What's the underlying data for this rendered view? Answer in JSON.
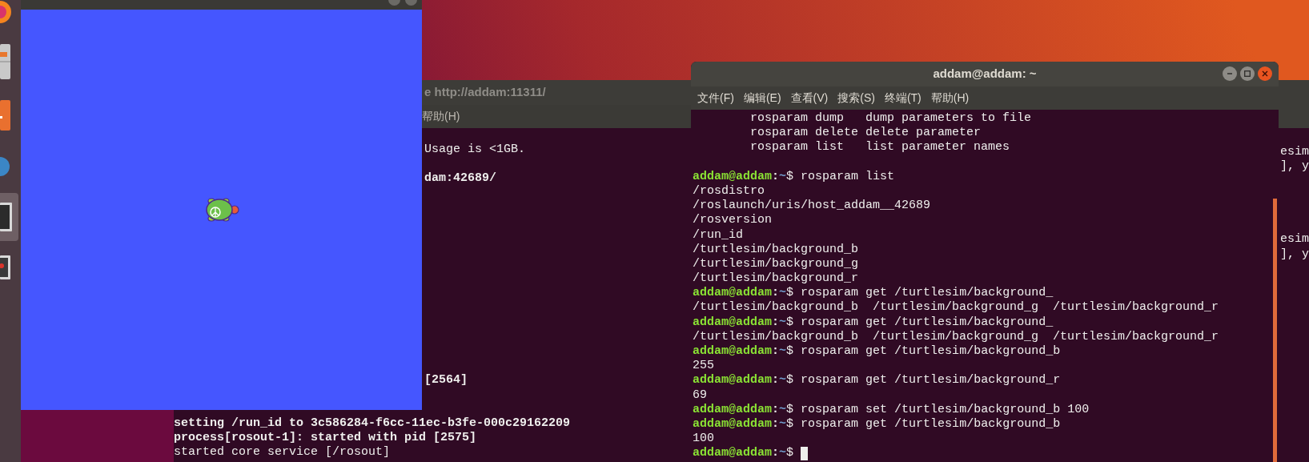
{
  "dock": {
    "items": [
      {
        "kind": "browser",
        "selected": false
      },
      {
        "kind": "files",
        "selected": false
      },
      {
        "kind": "software",
        "selected": false
      },
      {
        "kind": "globe",
        "selected": false
      },
      {
        "kind": "terminal",
        "selected": true
      },
      {
        "kind": "monitor",
        "selected": false
      }
    ]
  },
  "roscore_terminal": {
    "title": "e http://addam:11311/",
    "menu": [
      "帮助(H)"
    ],
    "lines": [
      {
        "kind": "blank"
      },
      {
        "kind": "output",
        "text": "Usage is <1GB.",
        "bold": false,
        "partly_covered": true
      },
      {
        "kind": "blank"
      },
      {
        "kind": "output",
        "text": "dam:42689/",
        "bold": true,
        "partly_covered": true
      },
      {
        "kind": "blank"
      },
      {
        "kind": "blank"
      },
      {
        "kind": "blank"
      },
      {
        "kind": "blank"
      },
      {
        "kind": "blank"
      },
      {
        "kind": "blank"
      },
      {
        "kind": "blank"
      },
      {
        "kind": "blank"
      },
      {
        "kind": "blank"
      },
      {
        "kind": "blank"
      },
      {
        "kind": "blank"
      },
      {
        "kind": "blank"
      },
      {
        "kind": "blank"
      },
      {
        "kind": "output",
        "text": "[2564]",
        "bold": true,
        "partly_covered": true
      },
      {
        "kind": "blank"
      },
      {
        "kind": "blank"
      },
      {
        "kind": "output",
        "text": "setting /run_id to 3c586284-f6cc-11ec-b3fe-000c29162209",
        "bold": true,
        "partly_covered": false
      },
      {
        "kind": "output",
        "text": "process[rosout-1]: started with pid [2575]",
        "bold": true,
        "partly_covered": false
      },
      {
        "kind": "output",
        "text": "started core service [/rosout]",
        "bold": false,
        "partly_covered": false
      }
    ]
  },
  "side_terminal": {
    "lines": [
      {
        "kind": "blank"
      },
      {
        "kind": "output",
        "text": "esim"
      },
      {
        "kind": "output",
        "text": "], y"
      },
      {
        "kind": "blank"
      },
      {
        "kind": "blank"
      },
      {
        "kind": "blank"
      },
      {
        "kind": "blank"
      },
      {
        "kind": "output",
        "text": "esim"
      },
      {
        "kind": "output",
        "text": "], y"
      }
    ]
  },
  "main_terminal": {
    "title": "addam@addam: ~",
    "menu": [
      "文件(F)",
      "编辑(E)",
      "查看(V)",
      "搜索(S)",
      "终端(T)",
      "帮助(H)"
    ],
    "lines": [
      {
        "kind": "output",
        "text": "        rosparam dump   dump parameters to file"
      },
      {
        "kind": "output",
        "text": "        rosparam delete delete parameter"
      },
      {
        "kind": "output",
        "text": "        rosparam list   list parameter names"
      },
      {
        "kind": "blank"
      },
      {
        "kind": "prompt",
        "user": "addam@addam",
        "separator": ":",
        "path": "~",
        "symbol": "$",
        "command": "rosparam list",
        "cursor": false
      },
      {
        "kind": "output",
        "text": "/rosdistro"
      },
      {
        "kind": "output",
        "text": "/roslaunch/uris/host_addam__42689"
      },
      {
        "kind": "output",
        "text": "/rosversion"
      },
      {
        "kind": "output",
        "text": "/run_id"
      },
      {
        "kind": "output",
        "text": "/turtlesim/background_b"
      },
      {
        "kind": "output",
        "text": "/turtlesim/background_g"
      },
      {
        "kind": "output",
        "text": "/turtlesim/background_r"
      },
      {
        "kind": "prompt",
        "user": "addam@addam",
        "separator": ":",
        "path": "~",
        "symbol": "$",
        "command": "rosparam get /turtlesim/background_",
        "cursor": false
      },
      {
        "kind": "output",
        "text": "/turtlesim/background_b  /turtlesim/background_g  /turtlesim/background_r"
      },
      {
        "kind": "prompt",
        "user": "addam@addam",
        "separator": ":",
        "path": "~",
        "symbol": "$",
        "command": "rosparam get /turtlesim/background_",
        "cursor": false
      },
      {
        "kind": "output",
        "text": "/turtlesim/background_b  /turtlesim/background_g  /turtlesim/background_r"
      },
      {
        "kind": "prompt",
        "user": "addam@addam",
        "separator": ":",
        "path": "~",
        "symbol": "$",
        "command": "rosparam get /turtlesim/background_b",
        "cursor": false
      },
      {
        "kind": "output",
        "text": "255"
      },
      {
        "kind": "prompt",
        "user": "addam@addam",
        "separator": ":",
        "path": "~",
        "symbol": "$",
        "command": "rosparam get /turtlesim/background_r",
        "cursor": false
      },
      {
        "kind": "output",
        "text": "69"
      },
      {
        "kind": "prompt",
        "user": "addam@addam",
        "separator": ":",
        "path": "~",
        "symbol": "$",
        "command": "rosparam set /turtlesim/background_b 100",
        "cursor": false
      },
      {
        "kind": "prompt",
        "user": "addam@addam",
        "separator": ":",
        "path": "~",
        "symbol": "$",
        "command": "rosparam get /turtlesim/background_b",
        "cursor": false
      },
      {
        "kind": "output",
        "text": "100"
      },
      {
        "kind": "prompt",
        "user": "addam@addam",
        "separator": ":",
        "path": "~",
        "symbol": "$",
        "cursor": true
      }
    ]
  }
}
